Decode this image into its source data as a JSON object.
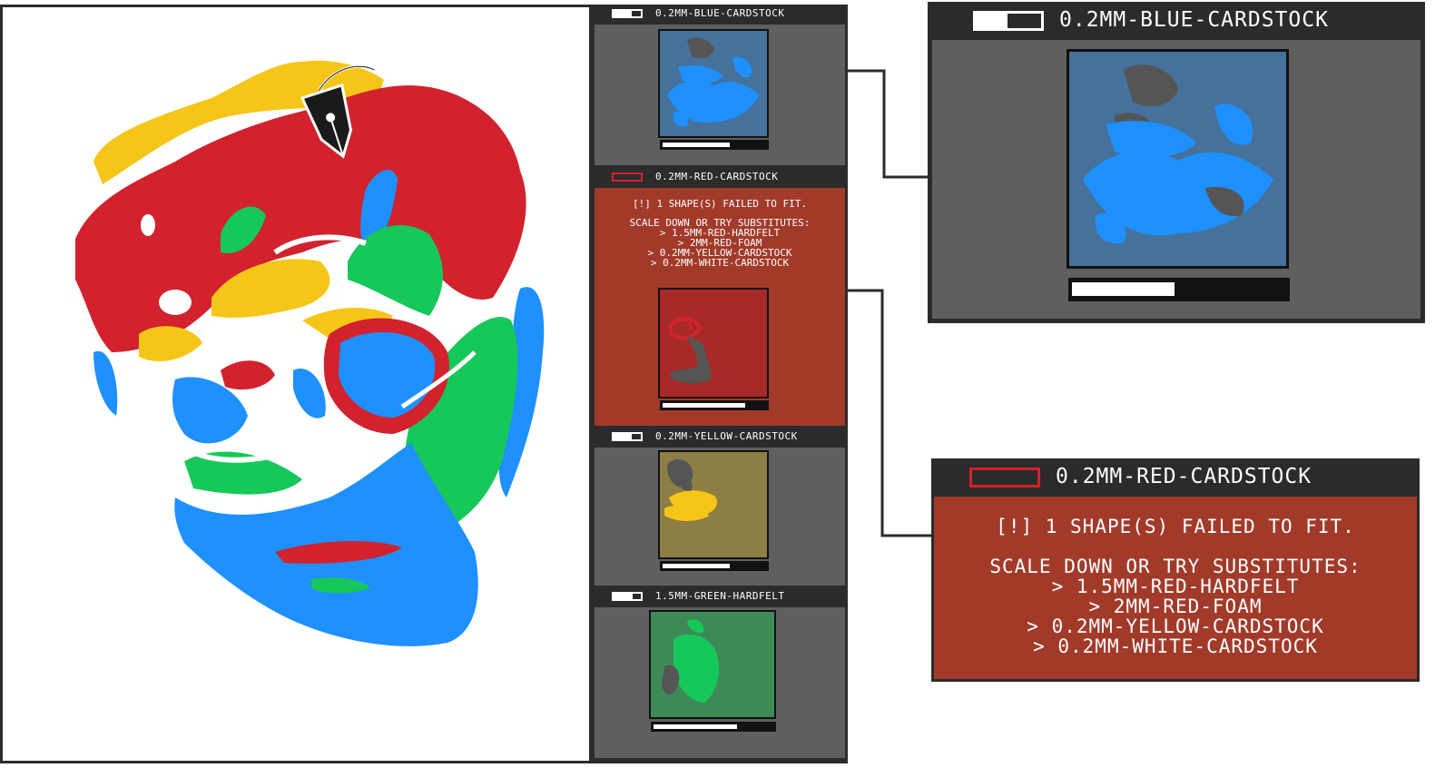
{
  "layers": [
    {
      "label": "0.2MM-BLUE-CARDSTOCK",
      "progress": 0.65,
      "color": "#1e90ff",
      "status": "ok"
    },
    {
      "label": "0.2MM-RED-CARDSTOCK",
      "progress": 0.8,
      "color": "#d1222d",
      "status": "error"
    },
    {
      "label": "0.2MM-YELLOW-CARDSTOCK",
      "progress": 0.65,
      "color": "#f5c518",
      "status": "ok"
    },
    {
      "label": "1.5MM-GREEN-HARDFELT",
      "progress": 0.7,
      "color": "#16c75a",
      "status": "ok"
    }
  ],
  "error": {
    "line1": "[!] 1 SHAPE(S) FAILED TO FIT.",
    "line2": "SCALE DOWN OR TRY SUBSTITUTES:",
    "substitutes": [
      "> 1.5MM-RED-HARDFELT",
      "> 2MM-RED-FOAM",
      "> 0.2MM-YELLOW-CARDSTOCK",
      "> 0.2MM-WHITE-CARDSTOCK"
    ]
  },
  "detail_blue": {
    "label": "0.2MM-BLUE-CARDSTOCK",
    "progress": 0.48
  },
  "detail_red": {
    "label": "0.2MM-RED-CARDSTOCK"
  },
  "colors": {
    "panel_bg": "#5f5f5f",
    "frame": "#2b2b2b",
    "error_bg": "#a23a2a",
    "red": "#d1222d",
    "blue": "#1e90ff",
    "yellow": "#f5c518",
    "green": "#16c75a"
  },
  "icons": {
    "tool": "pen-nib-icon"
  }
}
